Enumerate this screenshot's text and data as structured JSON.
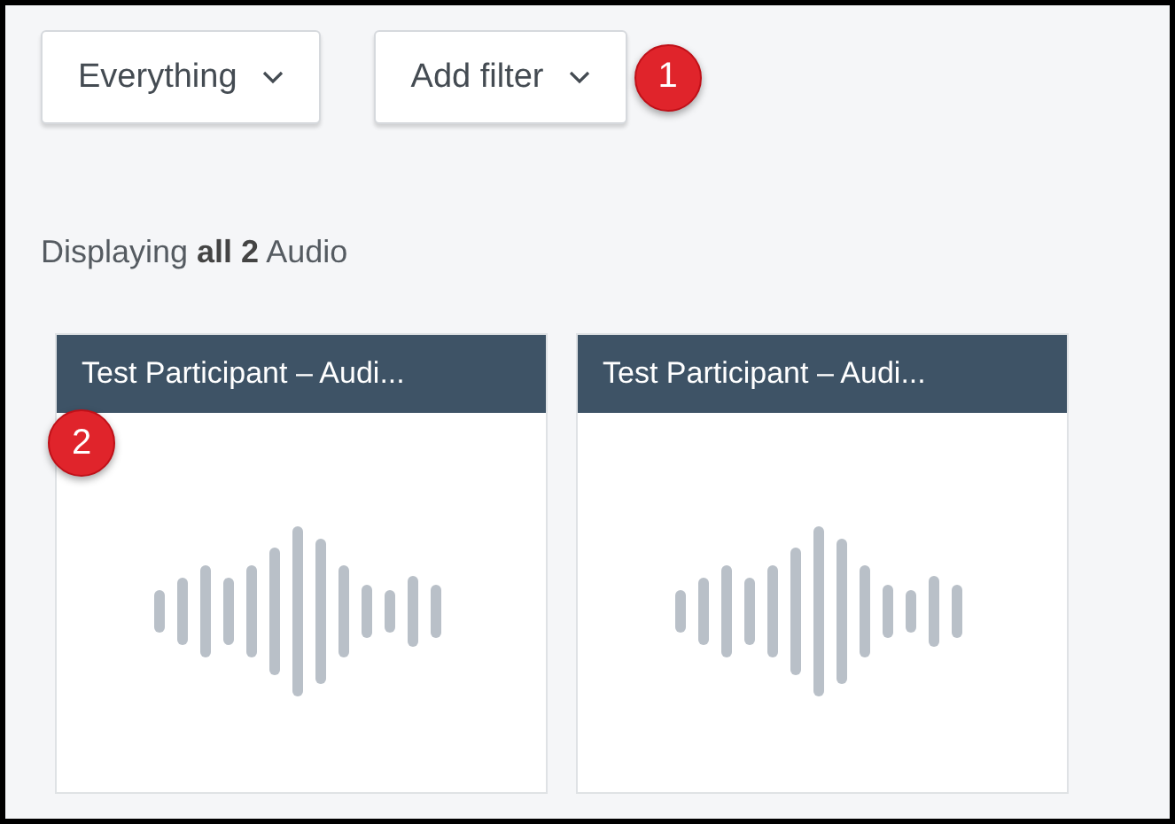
{
  "toolbar": {
    "dropdowns": [
      {
        "label": "Everything"
      },
      {
        "label": "Add filter"
      }
    ],
    "callout": "1"
  },
  "summary": "Displaying **all 2** Audio",
  "cards": [
    {
      "title": "Test Participant – Audi...",
      "callout": "2"
    },
    {
      "title": "Test Participant – Audi..."
    }
  ]
}
